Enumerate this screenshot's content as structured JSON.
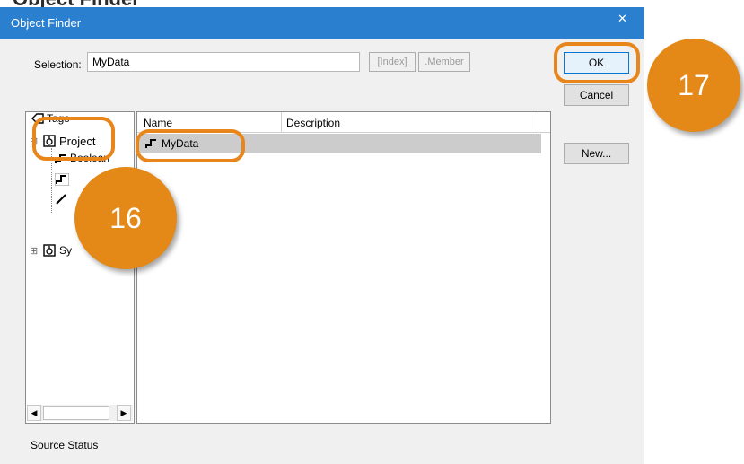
{
  "heading_fragment": "Object Finder",
  "dialog": {
    "title": "Object Finder",
    "close_glyph": "✕"
  },
  "selection": {
    "label": "Selection:",
    "value": "MyData",
    "index_button": "[Index]",
    "member_button": ".Member"
  },
  "buttons": {
    "ok": "OK",
    "cancel": "Cancel",
    "new": "New..."
  },
  "tree": {
    "root_label": "Tags",
    "project_label": "Project",
    "project_child_1": "Boolean",
    "system_label": "Sy",
    "expand_minus": "⊟",
    "expand_plus": "⊞"
  },
  "list": {
    "columns": [
      "Name",
      "Description"
    ],
    "rows": [
      {
        "name": "MyData",
        "description": ""
      }
    ]
  },
  "status": {
    "text": "Source Status"
  },
  "callouts": {
    "step_16": "16",
    "step_17": "17"
  },
  "colors": {
    "titlebar": "#2b7fcf",
    "callout_orange": "#e48818",
    "selected_row": "#cccccc"
  },
  "icons": {
    "close": "close-icon",
    "tag_root": "tag-icon",
    "project": "project-icon",
    "boolean_tag": "tag-step-icon",
    "system": "system-icon",
    "row_tag": "tag-step-icon"
  }
}
